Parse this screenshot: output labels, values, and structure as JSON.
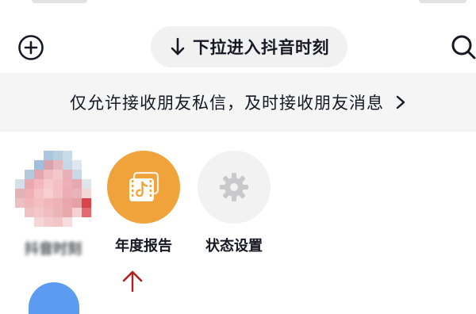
{
  "header": {
    "add_icon": "plus-circle-icon",
    "pull_text": "下拉进入抖音时刻",
    "pull_icon": "arrow-down-icon",
    "search_icon": "search-icon"
  },
  "notice": {
    "text": "仅允许接收朋友私信，及时接收朋友消息",
    "icon": "chevron-right-icon"
  },
  "shortcuts": [
    {
      "label": "抖音时刻",
      "icon": "blurred-avatar"
    },
    {
      "label": "年度报告",
      "icon": "video-card-icon",
      "color": "#f0a23b"
    },
    {
      "label": "状态设置",
      "icon": "gear-icon",
      "color": "#f2f2f3"
    }
  ],
  "annotation": {
    "icon": "red-arrow-icon",
    "color": "#b22020"
  }
}
